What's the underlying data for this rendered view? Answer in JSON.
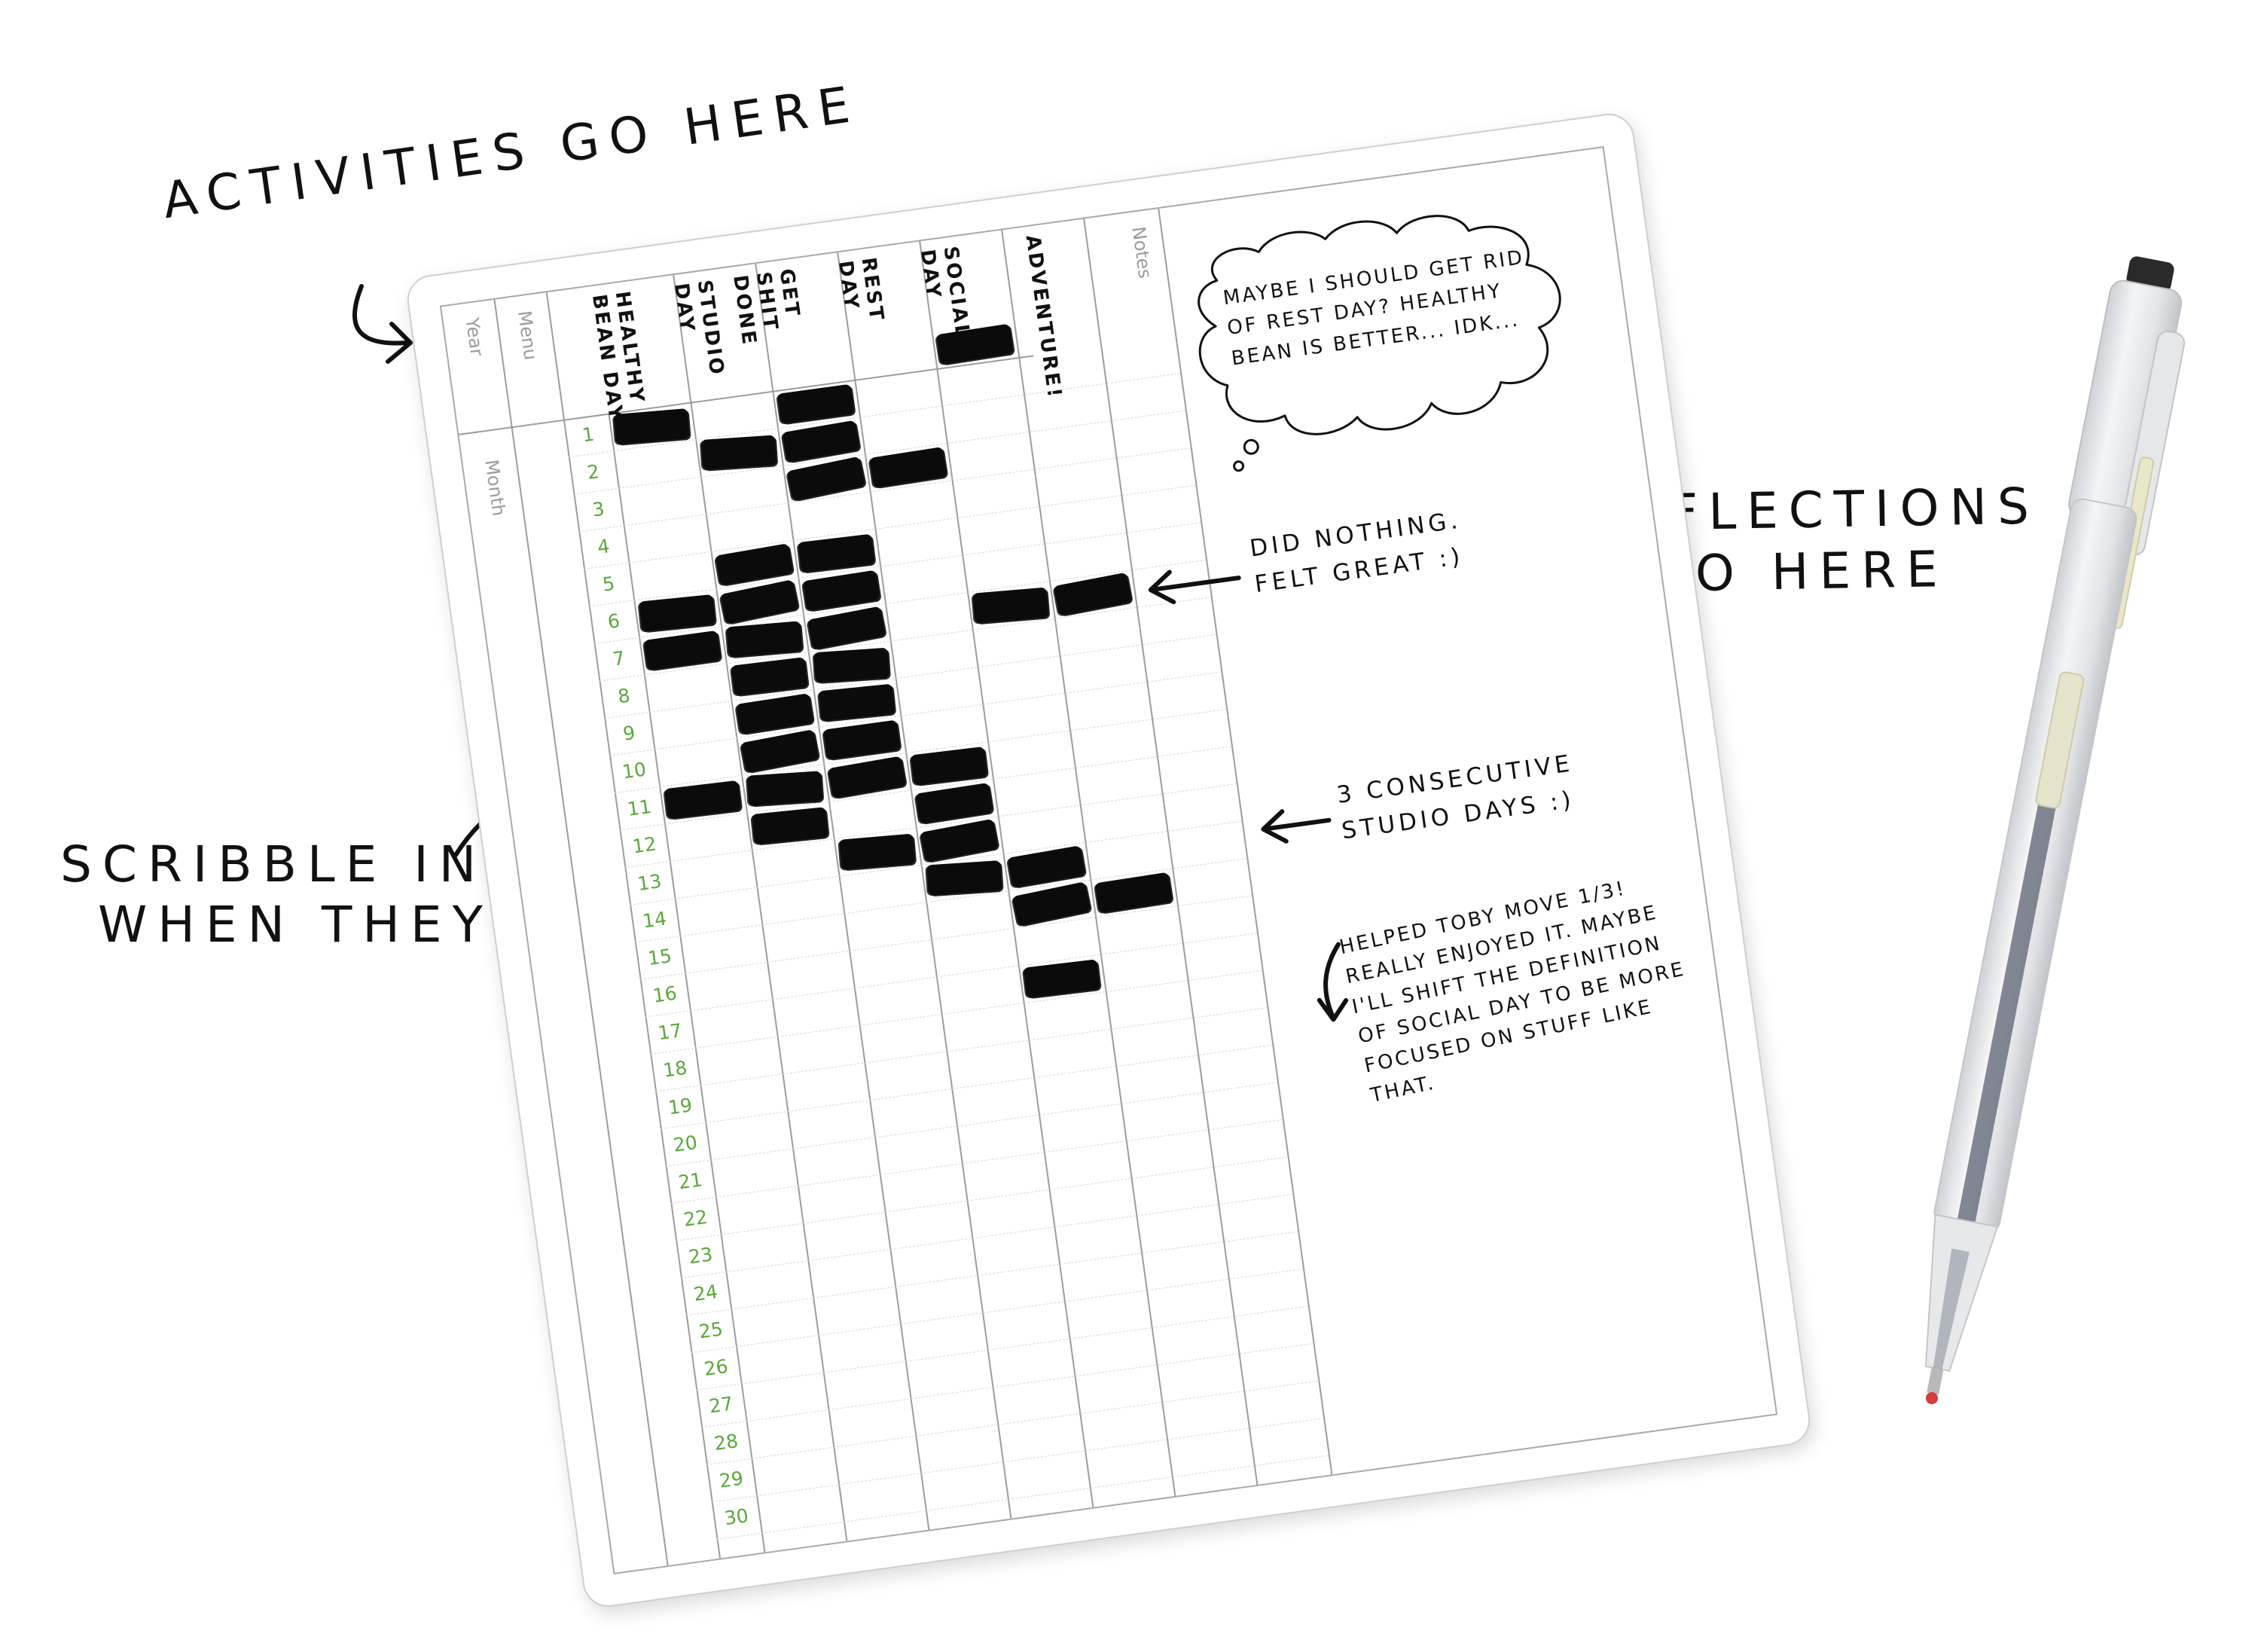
{
  "annotations": {
    "activities": "ACTIVITIES GO HERE",
    "reflections_line1": "REFLECTIONS",
    "reflections_line2": "GO HERE",
    "scribble_line1": "SCRIBBLE IN",
    "scribble_line2": "WHEN THEY HAPPEN"
  },
  "sheet": {
    "year_label": "Year",
    "menu_label": "Menu",
    "month_label": "Month",
    "notes_label": "Notes",
    "activities": [
      "HEALTHY BEAN DAY",
      "STUDIO DAY",
      "GET SHIT DONE",
      "REST DAY",
      "SOCIAL DAY",
      "ADVENTURE!"
    ],
    "days": [
      "1",
      "2",
      "3",
      "4",
      "5",
      "6",
      "7",
      "8",
      "9",
      "10",
      "11",
      "12",
      "13",
      "14",
      "15",
      "16",
      "17",
      "18",
      "19",
      "20",
      "21",
      "22",
      "23",
      "24",
      "25",
      "26",
      "27",
      "28",
      "29",
      "30"
    ],
    "marked_days": {
      "HEALTHY BEAN DAY": [
        1,
        6,
        7,
        11
      ],
      "STUDIO DAY": [
        2,
        5,
        6,
        7,
        8,
        9,
        10,
        11,
        12
      ],
      "GET SHIT DONE": [
        1,
        2,
        3,
        5,
        6,
        7,
        8,
        9,
        10,
        11,
        13
      ],
      "REST DAY": [
        3,
        11,
        12,
        13,
        14
      ],
      "SOCIAL DAY": [
        0,
        7,
        14,
        15,
        17
      ],
      "ADVENTURE!": [
        7,
        15
      ]
    }
  },
  "notes": {
    "thought_bubble": "MAYBE I SHOULD GET RID OF REST DAY? HEALTHY BEAN IS BETTER... IDK...",
    "did_nothing": "DID NOTHING. FELT GREAT :)",
    "consecutive": "3 CONSECUTIVE STUDIO DAYS :)",
    "helped_toby": "HELPED TOBY MOVE 1/3! REALLY ENJOYED IT. MAYBE I'LL SHIFT THE DEFINITION OF SOCIAL DAY TO BE MORE FOCUSED ON STUFF LIKE THAT."
  },
  "colors": {
    "day_number": "#5aa83b",
    "grid_line": "#9c9c9c",
    "ink": "#111111",
    "pen_tip": "#d63a3a"
  }
}
